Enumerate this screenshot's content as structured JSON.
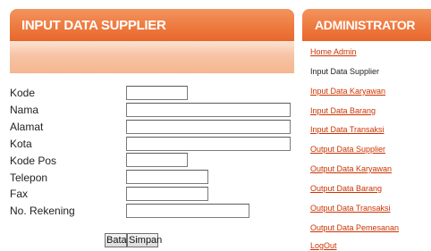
{
  "main": {
    "title": "INPUT DATA SUPPLIER"
  },
  "form": {
    "fields": [
      {
        "label": "Kode",
        "value": ""
      },
      {
        "label": "Nama",
        "value": ""
      },
      {
        "label": "Alamat",
        "value": ""
      },
      {
        "label": "Kota",
        "value": ""
      },
      {
        "label": "Kode Pos",
        "value": ""
      },
      {
        "label": "Telepon",
        "value": ""
      },
      {
        "label": "Fax",
        "value": ""
      },
      {
        "label": "No. Rekening",
        "value": ""
      }
    ],
    "cancel_label": "Batal",
    "save_label": "Simpan"
  },
  "sidebar": {
    "title": "ADMINISTRATOR",
    "items": [
      {
        "label": "Home Admin"
      },
      {
        "label": "Input Data Supplier"
      },
      {
        "label": "Input Data Karyawan"
      },
      {
        "label": "Input Data Barang"
      },
      {
        "label": "Input Data Transaksi"
      },
      {
        "label": "Output Data Supplier"
      },
      {
        "label": "Output Data Karyawan"
      },
      {
        "label": "Output Data Barang"
      },
      {
        "label": "Output Data Transaksi"
      },
      {
        "label": "Output Data Pemesanan"
      },
      {
        "label": "LogOut"
      }
    ]
  },
  "colors": {
    "header_orange": "#ee7a40",
    "link_red": "#cc3300"
  }
}
